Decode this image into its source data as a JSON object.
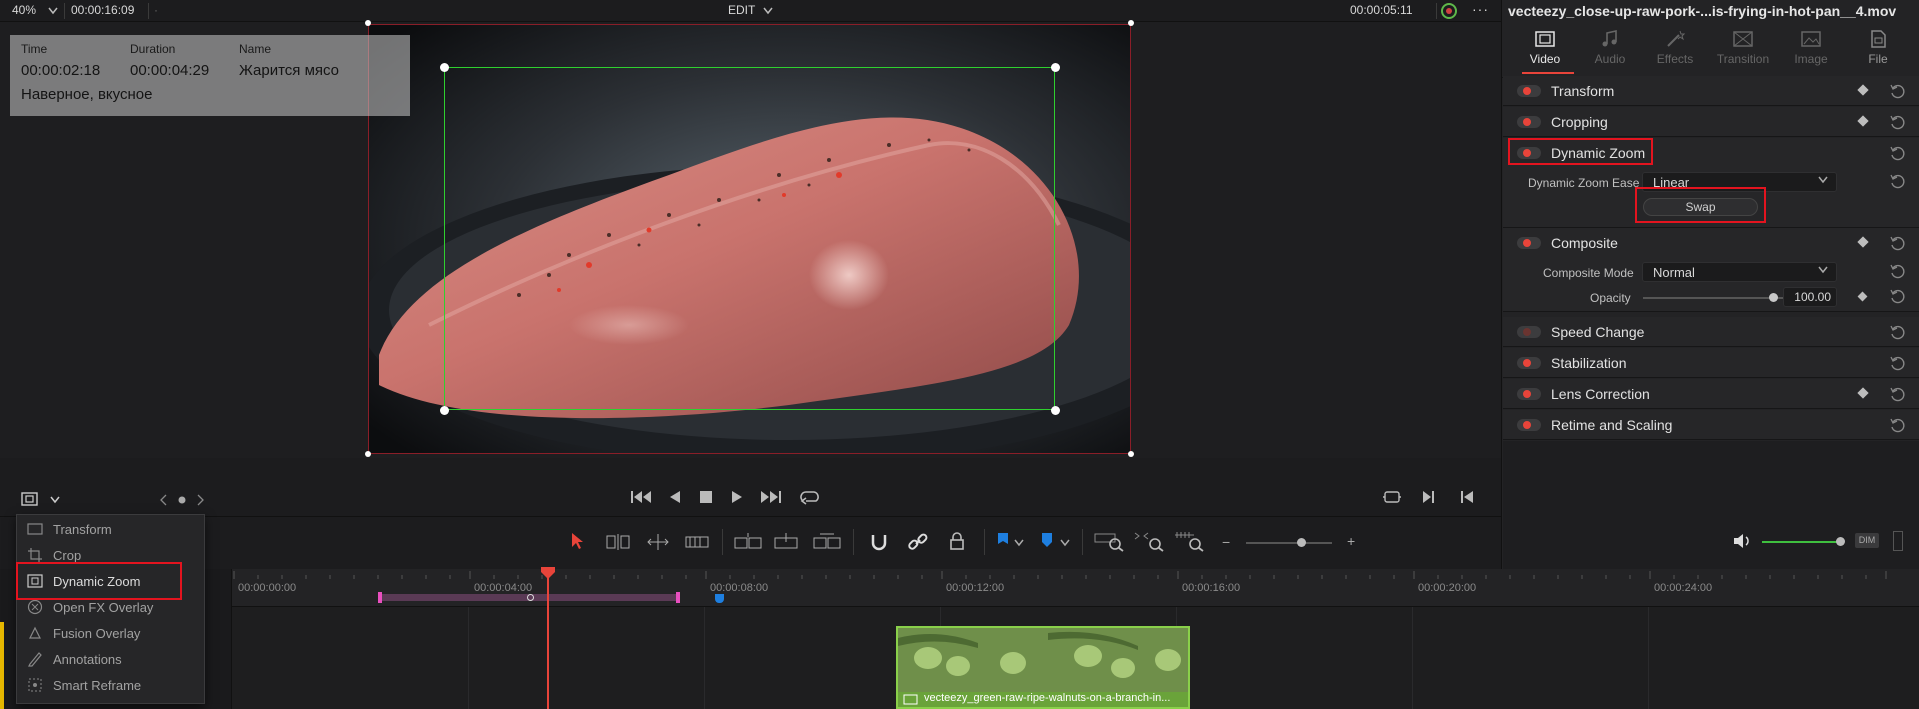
{
  "topbar": {
    "zoom": "40%",
    "timecode_left": "00:00:16:09",
    "mode": "EDIT",
    "timecode_right": "00:00:05:11"
  },
  "overlay": {
    "time_label": "Time",
    "time_value": "00:00:02:18",
    "duration_label": "Duration",
    "duration_value": "00:00:04:29",
    "name_label": "Name",
    "name_value": "Жарится мясо",
    "note": "Наверное, вкусное"
  },
  "inspector": {
    "file_title": "vecteezy_close-up-raw-pork-...is-frying-in-hot-pan__4.mov",
    "tabs": [
      {
        "label": "Video",
        "icon": "film-icon",
        "active": true
      },
      {
        "label": "Audio",
        "icon": "music-note-icon",
        "active": false
      },
      {
        "label": "Effects",
        "icon": "magic-wand-icon",
        "active": false
      },
      {
        "label": "Transition",
        "icon": "transition-icon",
        "active": false
      },
      {
        "label": "Image",
        "icon": "image-icon",
        "active": false
      },
      {
        "label": "File",
        "icon": "file-icon",
        "active": false
      }
    ],
    "sections": {
      "transform": "Transform",
      "cropping": "Cropping",
      "dynamic_zoom": "Dynamic Zoom",
      "composite": "Composite",
      "speed_change": "Speed Change",
      "stabilization": "Stabilization",
      "lens_correction": "Lens Correction",
      "retime": "Retime and Scaling"
    },
    "dynamic_zoom_ease_label": "Dynamic Zoom Ease",
    "dynamic_zoom_ease_value": "Linear",
    "swap_label": "Swap",
    "composite_mode_label": "Composite Mode",
    "composite_mode_value": "Normal",
    "opacity_label": "Opacity",
    "opacity_value": "100.00"
  },
  "menu": {
    "items": [
      {
        "label": "Transform",
        "icon": "transform-icon"
      },
      {
        "label": "Crop",
        "icon": "crop-icon"
      },
      {
        "label": "Dynamic Zoom",
        "icon": "dynamic-zoom-icon"
      },
      {
        "label": "Open FX Overlay",
        "icon": "fx-icon"
      },
      {
        "label": "Fusion Overlay",
        "icon": "fusion-icon"
      },
      {
        "label": "Annotations",
        "icon": "pen-icon"
      },
      {
        "label": "Smart Reframe",
        "icon": "reframe-icon"
      }
    ]
  },
  "timeline": {
    "ruler_ticks": [
      "00:00:00:00",
      "00:00:04:00",
      "00:00:08:00",
      "00:00:12:00",
      "00:00:16:00",
      "00:00:20:00",
      "00:00:24:00"
    ],
    "clip_name": "vecteezy_green-raw-ripe-walnuts-on-a-branch-in...",
    "dim_label": "DIM"
  },
  "colors": {
    "accent_red": "#e8443a",
    "highlight_box": "#e3141f",
    "zoom_box": "#2fd02f",
    "clip_green": "#8ad04a",
    "marker_blue": "#1e7fe0",
    "range_pink": "#e94fbf"
  }
}
